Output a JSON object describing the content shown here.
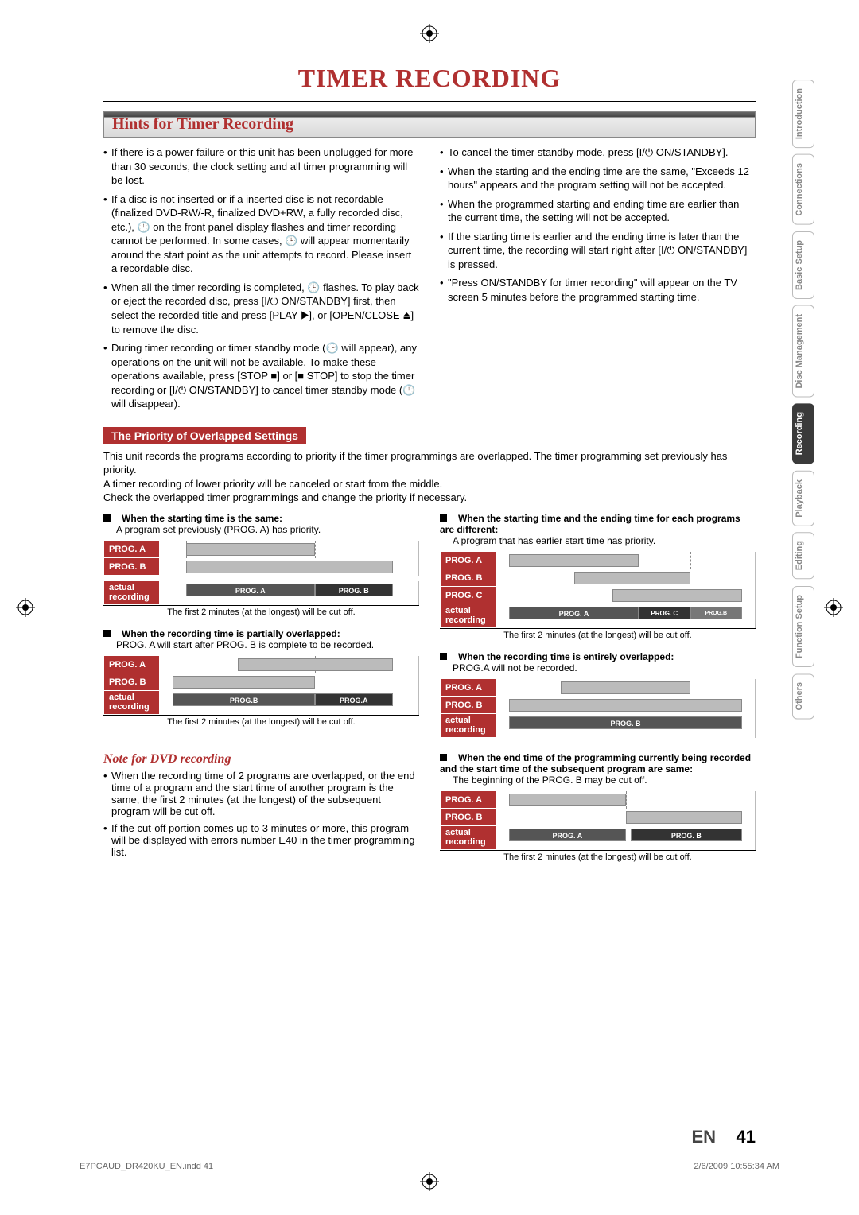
{
  "title": "TIMER RECORDING",
  "section_header": "Hints for Timer Recording",
  "hints_left": [
    "If there is a power failure or this unit has been unplugged for more than 30 seconds, the clock setting and all timer programming will be lost.",
    "If a disc is not inserted or if a inserted disc is not recordable (finalized DVD-RW/-R, finalized DVD+RW, a fully recorded disc, etc.), 🕒 on the front panel display flashes and timer recording cannot be performed. In some cases, 🕒 will appear momentarily around the start point as the unit attempts to record. Please insert a recordable disc.",
    "When all the timer recording is completed, 🕒 flashes. To play back or eject the recorded disc, press [I/⏻ ON/STANDBY] first, then select the recorded title and press [PLAY ▶], or [OPEN/CLOSE ⏏] to remove the disc.",
    "During timer recording or timer standby mode (🕒 will appear), any operations on the unit will not be available. To make these operations available, press [STOP ■] or [■ STOP] to stop the timer recording or [I/⏻ ON/STANDBY] to cancel timer standby mode (🕒 will disappear)."
  ],
  "hints_right": [
    "To cancel the timer standby mode, press [I/⏻ ON/STANDBY].",
    "When the starting and the ending time are the same, \"Exceeds 12 hours\" appears and the program setting will not be accepted.",
    "When the programmed starting and ending time are earlier than the current time, the setting will not be accepted.",
    "If the starting time is earlier and the ending time is later than the current time, the recording will start right after [I/⏻ ON/STANDBY] is pressed.",
    "\"Press ON/STANDBY for timer recording\" will appear on the TV screen 5 minutes before the programmed starting time."
  ],
  "sub_header": "The Priority of Overlapped Settings",
  "priority_body": [
    "This unit records the programs according to priority if the timer programmings are overlapped. The timer programming set previously has priority.",
    "A timer recording of lower priority will be canceled or start from the middle.",
    "Check the overlapped timer programmings and change the priority if necessary."
  ],
  "scen1": {
    "head": "When the starting time is the same:",
    "sub": "A program set previously (PROG. A) has priority."
  },
  "scen2": {
    "head": "When the starting time and the ending time for each programs are different:",
    "sub": "A program that has earlier start time has priority."
  },
  "scen3": {
    "head": "When the recording time is partially overlapped:",
    "sub": "PROG. A will start after PROG. B is complete to be recorded."
  },
  "scen4": {
    "head": "When the recording time is entirely overlapped:",
    "sub": "PROG.A will not be recorded."
  },
  "scen5": {
    "head": "When the end time of the programming currently being recorded and the start time of the subsequent program are same:",
    "sub": "The beginning of the PROG. B may be cut off."
  },
  "cutoff_note": "The first 2 minutes (at the longest) will be cut off.",
  "labels": {
    "progA": "PROG. A",
    "progB": "PROG. B",
    "progC": "PROG. C",
    "actual": "actual recording"
  },
  "dvd_note": {
    "title": "Note for DVD recording",
    "items": [
      "When the recording time of 2 programs are overlapped, or the end time of a program and the start time of another program is the same, the first 2 minutes (at the longest) of the subsequent program will be cut off.",
      "If the cut-off portion comes up to 3 minutes or more, this program will be displayed with errors number E40 in the timer programming list."
    ]
  },
  "side_tabs": [
    "Introduction",
    "Connections",
    "Basic Setup",
    "Disc Management",
    "Recording",
    "Playback",
    "Editing",
    "Function Setup",
    "Others"
  ],
  "active_tab_index": 4,
  "page_lang": "EN",
  "page_num": "41",
  "footer_left": "E7PCAUD_DR420KU_EN.indd   41",
  "footer_right": "2/6/2009   10:55:34 AM",
  "chart_data": [
    {
      "id": "s1",
      "type": "bar",
      "rows": [
        "PROG. A",
        "PROG. B",
        "actual recording"
      ],
      "bars": {
        "PROG. A": [
          [
            10,
            60
          ]
        ],
        "PROG. B": [
          [
            10,
            90
          ]
        ],
        "actual": [
          [
            10,
            60,
            "PROG. A"
          ],
          [
            60,
            90,
            "PROG. B"
          ]
        ]
      },
      "note": "The first 2 minutes (at the longest) will be cut off."
    },
    {
      "id": "s2",
      "type": "bar",
      "rows": [
        "PROG. A",
        "PROG. B",
        "PROG. C",
        "actual recording"
      ],
      "bars": {
        "PROG. A": [
          [
            5,
            55
          ]
        ],
        "PROG. B": [
          [
            30,
            75
          ]
        ],
        "PROG. C": [
          [
            45,
            95
          ]
        ],
        "actual": [
          [
            5,
            55,
            "PROG. A"
          ],
          [
            55,
            75,
            "PROG. C"
          ],
          [
            75,
            95,
            "PROG. B"
          ]
        ]
      },
      "note": "The first 2 minutes (at the longest) will be cut off."
    },
    {
      "id": "s3",
      "type": "bar",
      "rows": [
        "PROG. A",
        "PROG. B",
        "actual recording"
      ],
      "bars": {
        "PROG. A": [
          [
            30,
            90
          ]
        ],
        "PROG. B": [
          [
            5,
            60
          ]
        ],
        "actual": [
          [
            5,
            60,
            "PROG.B"
          ],
          [
            60,
            90,
            "PROG.A"
          ]
        ]
      },
      "note": "The first 2 minutes (at the longest) will be cut off."
    },
    {
      "id": "s4",
      "type": "bar",
      "rows": [
        "PROG. A",
        "PROG. B",
        "actual recording"
      ],
      "bars": {
        "PROG. A": [
          [
            25,
            75
          ]
        ],
        "PROG. B": [
          [
            5,
            95
          ]
        ],
        "actual": [
          [
            5,
            95,
            "PROG. B"
          ]
        ]
      }
    },
    {
      "id": "s5",
      "type": "bar",
      "rows": [
        "PROG. A",
        "PROG. B",
        "actual recording"
      ],
      "bars": {
        "PROG. A": [
          [
            5,
            50
          ]
        ],
        "PROG. B": [
          [
            50,
            95
          ]
        ],
        "actual": [
          [
            5,
            50,
            "PROG. A"
          ],
          [
            52,
            95,
            "PROG. B"
          ]
        ]
      },
      "note": "The first 2 minutes (at the longest) will be cut off."
    }
  ]
}
